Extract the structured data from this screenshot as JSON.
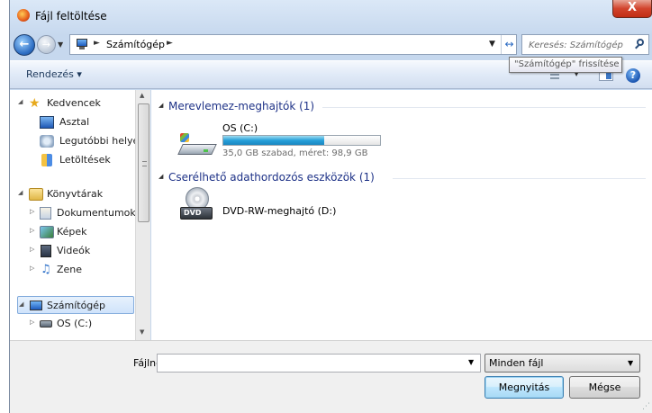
{
  "window": {
    "title": "Fájl feltöltése",
    "close_label": "X"
  },
  "address": {
    "location": "Számítógép",
    "sep": "►"
  },
  "search": {
    "placeholder": "Keresés: Számítógép"
  },
  "tooltip": {
    "text": "\"Számítógép\" frissítése"
  },
  "toolbar": {
    "organize_label": "Rendezés ▾",
    "help_label": "?"
  },
  "navpane": {
    "favorites": "Kedvencek",
    "desktop": "Asztal",
    "recent": "Legutóbbi helyek",
    "downloads": "Letöltések",
    "libraries": "Könyvtárak",
    "documents": "Dokumentumok",
    "pictures": "Képek",
    "videos": "Videók",
    "music": "Zene",
    "computer": "Számítógép",
    "os_drive": "OS (C:)"
  },
  "content": {
    "hdd_group": "Merevlemez-meghajtók (1)",
    "removable_group": "Cserélhető adathordozós eszközök (1)",
    "drive_c_name": "OS (C:)",
    "drive_c_detail": "35,0 GB szabad, méret: 98,9 GB",
    "drive_c_used_fraction": 0.646,
    "dvd_name": "DVD-RW-meghajtó (D:)",
    "dvd_label": "DVD"
  },
  "bottom": {
    "filename_label": "Fájlnév:",
    "filename_value": "",
    "filter_value": "Minden fájl",
    "open_label": "Megnyitás",
    "cancel_label": "Mégse"
  },
  "colors": {
    "accent": "#26a0da",
    "group_header": "#1e3287"
  }
}
